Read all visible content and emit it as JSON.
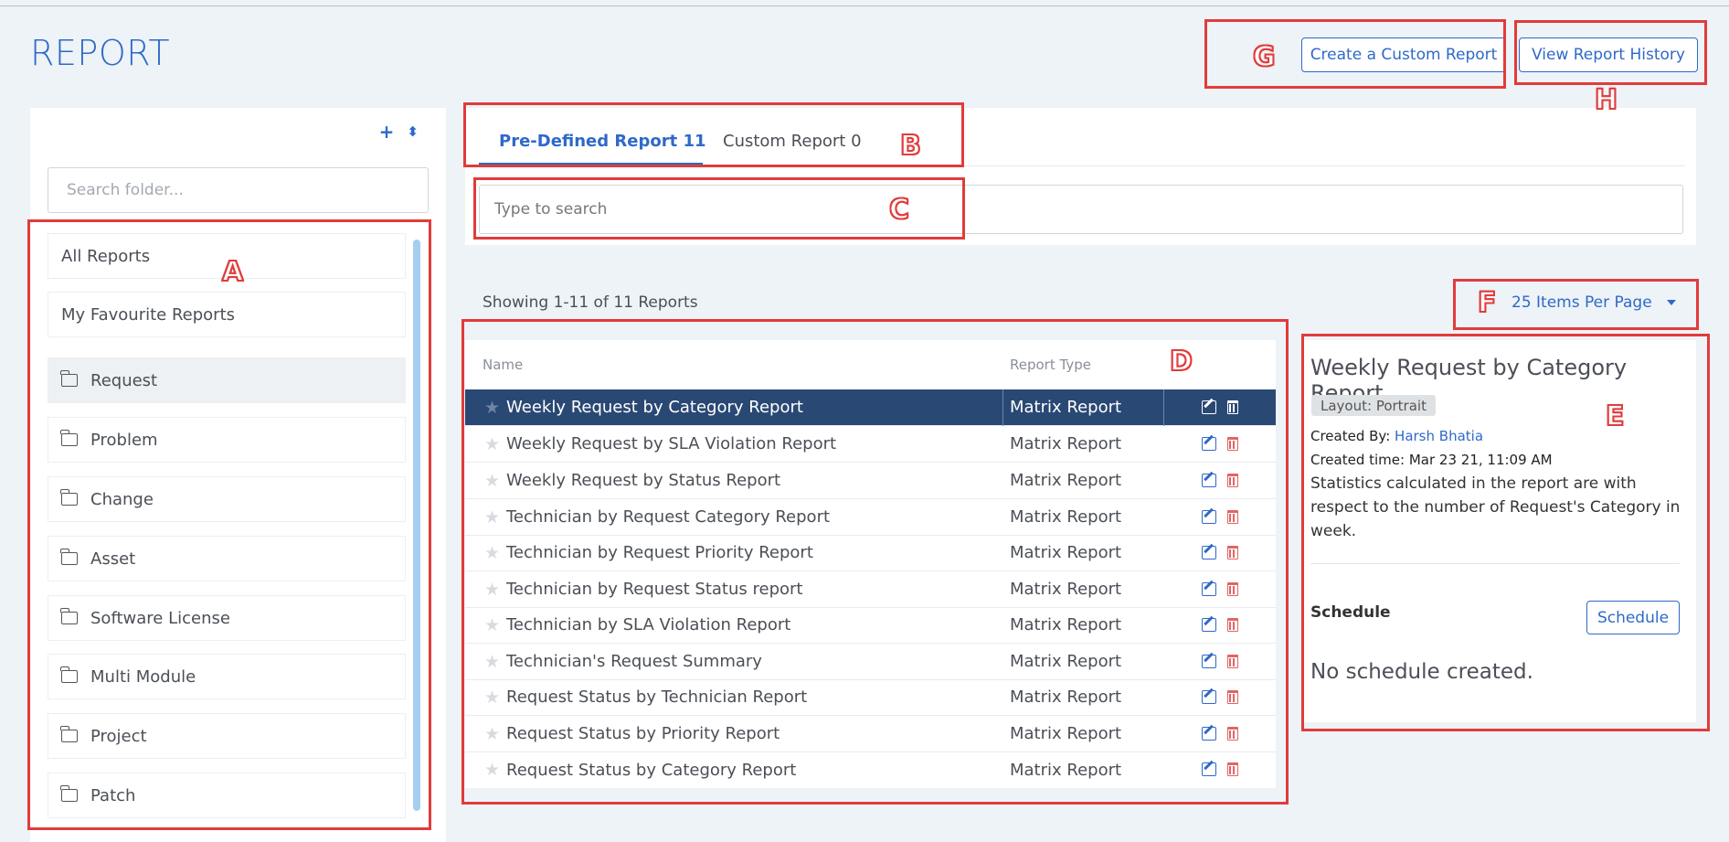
{
  "page": {
    "title": "REPORT"
  },
  "header": {
    "create_button": "Create a Custom Report",
    "history_button": "View Report History"
  },
  "sidebar": {
    "search_placeholder": "Search folder...",
    "items": [
      {
        "label": "All Reports",
        "icon": ""
      },
      {
        "label": "My Favourite Reports",
        "icon": ""
      },
      {
        "label": "Request",
        "icon": "folder-icon"
      },
      {
        "label": "Problem",
        "icon": "folder-icon"
      },
      {
        "label": "Change",
        "icon": "folder-icon"
      },
      {
        "label": "Asset",
        "icon": "folder-icon"
      },
      {
        "label": "Software License",
        "icon": "folder-icon"
      },
      {
        "label": "Multi Module",
        "icon": "folder-icon"
      },
      {
        "label": "Project",
        "icon": "folder-icon"
      },
      {
        "label": "Patch",
        "icon": "folder-icon"
      }
    ],
    "active_item": "Request"
  },
  "tabs": [
    {
      "label": "Pre-Defined Report 11",
      "active": true
    },
    {
      "label": "Custom Report 0",
      "active": false
    }
  ],
  "search": {
    "placeholder": "Type to search"
  },
  "listing": {
    "showing": "Showing 1-11 of 11 Reports",
    "per_page": "25 Items Per Page"
  },
  "table": {
    "columns": [
      "Name",
      "Report Type"
    ],
    "rows": [
      {
        "name": "Weekly Request by Category Report",
        "type": "Matrix Report",
        "selected": true
      },
      {
        "name": "Weekly Request by SLA Violation Report",
        "type": "Matrix Report"
      },
      {
        "name": "Weekly Request by Status Report",
        "type": "Matrix Report"
      },
      {
        "name": "Technician by Request Category Report",
        "type": "Matrix Report"
      },
      {
        "name": "Technician by Request Priority Report",
        "type": "Matrix Report"
      },
      {
        "name": "Technician by Request Status report",
        "type": "Matrix Report"
      },
      {
        "name": "Technician by SLA Violation Report",
        "type": "Matrix Report"
      },
      {
        "name": "Technician's Request Summary",
        "type": "Matrix Report"
      },
      {
        "name": "Request Status by Technician Report",
        "type": "Matrix Report"
      },
      {
        "name": "Request Status by Priority Report",
        "type": "Matrix Report"
      },
      {
        "name": "Request Status by Category Report",
        "type": "Matrix Report"
      }
    ]
  },
  "details": {
    "title": "Weekly Request by Category Report",
    "layout_badge": "Layout: Portrait",
    "created_by_label": "Created By:",
    "created_by": "Harsh Bhatia",
    "created_time_label": "Created time:",
    "created_time": "Mar 23 21, 11:09 AM",
    "description": "Statistics calculated in the report are with respect to the number of Request's Category in week.",
    "schedule_label": "Schedule",
    "schedule_button": "Schedule",
    "no_schedule": "No schedule created."
  },
  "annotations": [
    "A",
    "B",
    "C",
    "D",
    "E",
    "F",
    "G",
    "H"
  ],
  "colors": {
    "accent": "#2f69c8",
    "selected_row": "#2a4874",
    "annotation": "#e23b3b",
    "background": "#edf3f7"
  }
}
